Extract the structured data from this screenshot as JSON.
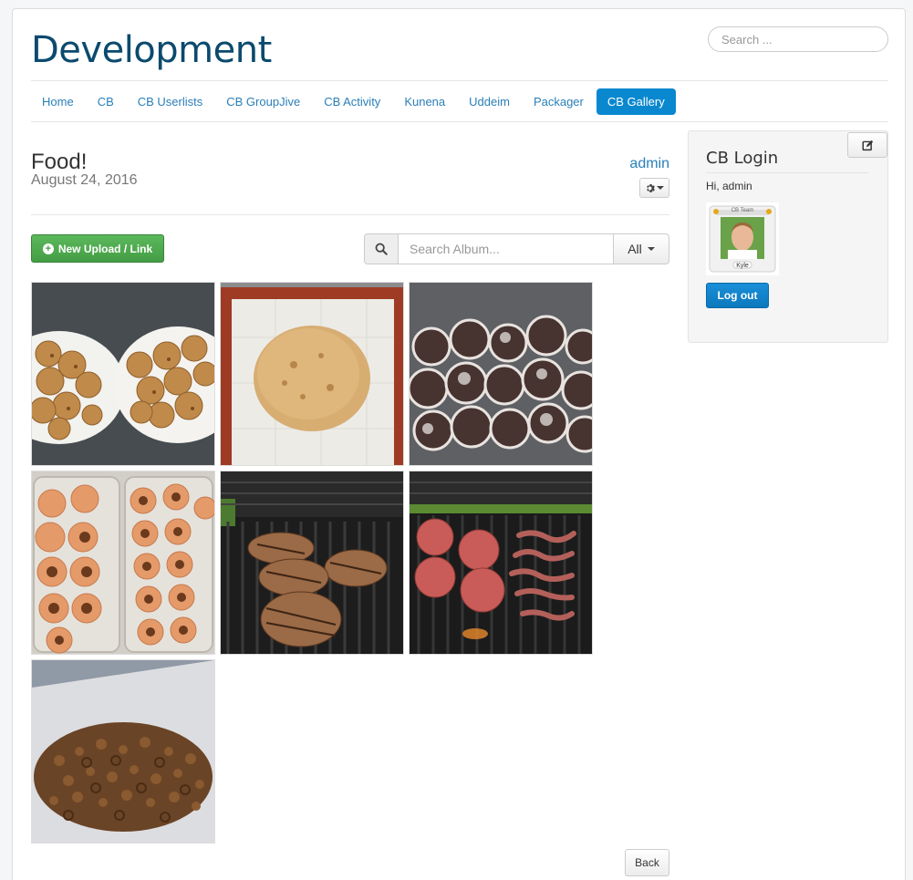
{
  "site": {
    "title": "Development"
  },
  "search": {
    "placeholder": "Search ..."
  },
  "nav": {
    "items": [
      {
        "label": "Home",
        "active": false
      },
      {
        "label": "CB",
        "active": false
      },
      {
        "label": "CB Userlists",
        "active": false
      },
      {
        "label": "CB GroupJive",
        "active": false
      },
      {
        "label": "CB Activity",
        "active": false
      },
      {
        "label": "Kunena",
        "active": false
      },
      {
        "label": "Uddeim",
        "active": false
      },
      {
        "label": "Packager",
        "active": false
      },
      {
        "label": "CB Gallery",
        "active": true
      }
    ]
  },
  "album": {
    "title": "Food!",
    "date": "August 24, 2016",
    "owner": "admin",
    "new_button_label": "New Upload / Link",
    "search_placeholder": "Search Album...",
    "filter_label": "All",
    "back_label": "Back",
    "photos": [
      {
        "subject": "chocolate chip cookies on plates"
      },
      {
        "subject": "cookie dough on baking mat"
      },
      {
        "subject": "chocolate crinkle cookies"
      },
      {
        "subject": "peanut butter blossom cookies"
      },
      {
        "subject": "grilled steaks"
      },
      {
        "subject": "burgers and bacon on grill"
      },
      {
        "subject": "pretzel snack mix"
      }
    ]
  },
  "login": {
    "title": "CB Login",
    "greeting": "Hi, admin",
    "avatar_badge": "CB Team",
    "avatar_name": "Kyle",
    "logout_label": "Log out"
  },
  "colors": {
    "brand": "#0b4a6e",
    "link": "#2a7fb8",
    "active_tab": "#0a88cf",
    "success": "#5cb85c"
  }
}
